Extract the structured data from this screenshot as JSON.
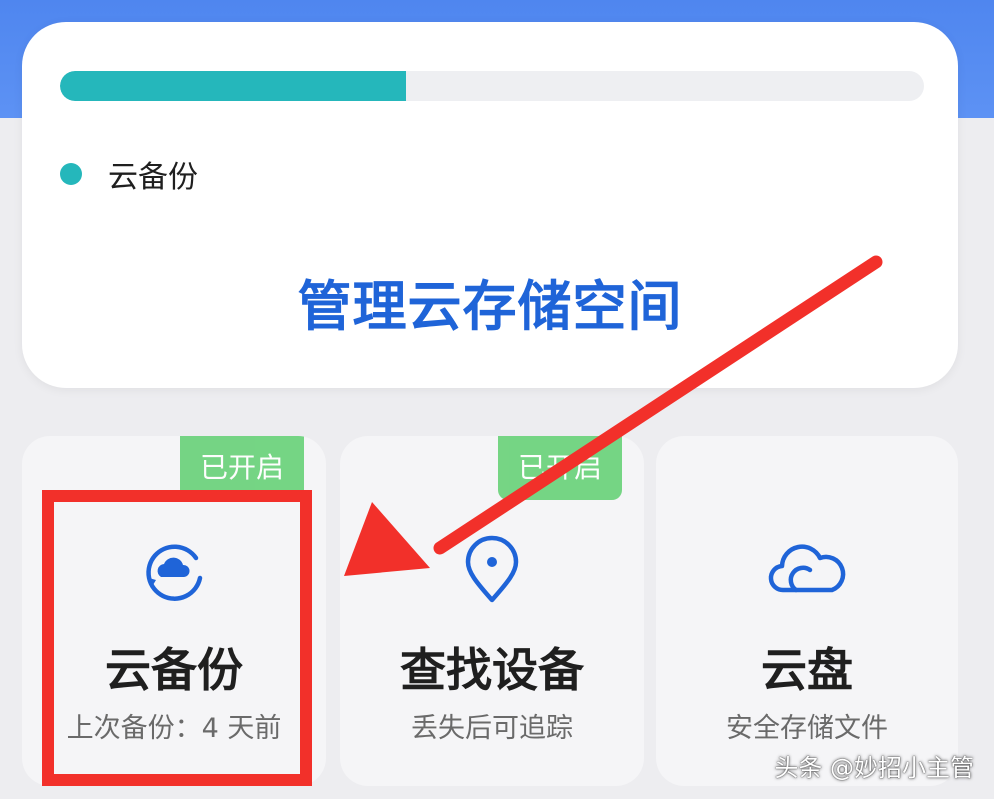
{
  "storage": {
    "used_fraction": 0.4,
    "legend_label": "云备份",
    "manage_link": "管理云存储空间"
  },
  "tiles": [
    {
      "title": "云备份",
      "subtitle": "上次备份：4 天前",
      "badge": "已开启",
      "icon": "cloud-backup-icon"
    },
    {
      "title": "查找设备",
      "subtitle": "丢失后可追踪",
      "badge": "已开启",
      "icon": "location-pin-icon"
    },
    {
      "title": "云盘",
      "subtitle": "安全存储文件",
      "icon": "cloud-icon"
    }
  ],
  "watermark": "头条 @妙招小主管",
  "colors": {
    "accent_blue": "#1f64d8",
    "usage_teal": "#25b7bb",
    "badge_green": "#5fcf70",
    "annotation_red": "#f2302a",
    "header_blue": "#4f86ef"
  }
}
